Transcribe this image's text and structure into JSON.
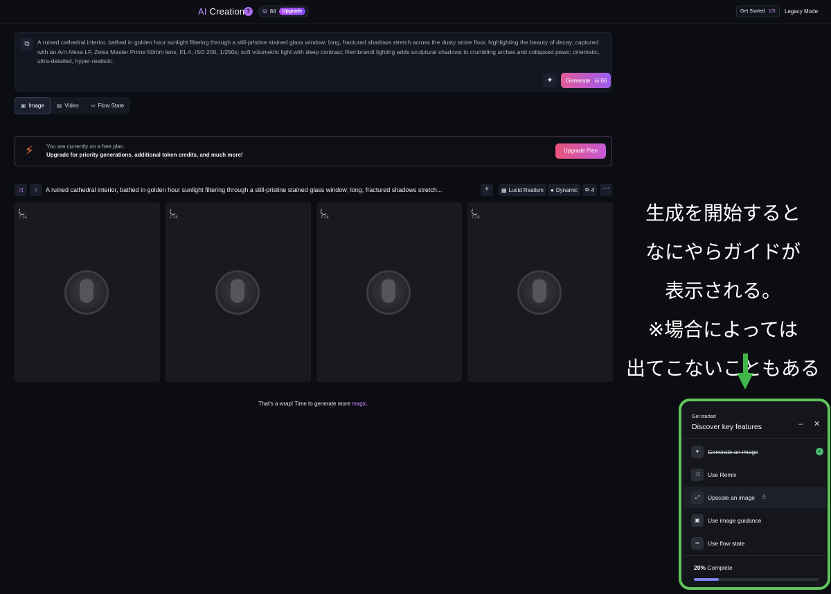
{
  "topbar": {
    "title_ai": "AI",
    "title_rest": " Creation",
    "help_icon": "?",
    "tokens": "84",
    "upgrade_badge": "Upgrade",
    "get_started_label": "Get Started",
    "get_started_count": "1/5",
    "legacy_mode": "Legacy Mode"
  },
  "prompt": {
    "text": "A ruined cathedral interior, bathed in golden hour sunlight filtering through a still-pristine stained glass window; long, fractured shadows stretch across the dusty stone floor, highlighting the beauty of decay; captured with an Arri Alexa LF, Zeiss Master Prime 50mm lens, f/1.4, ISO 200, 1/250s; soft volumetric light with deep contrast; Rembrandt lighting adds sculptural shadows to crumbling arches and collapsed pews; cinematic, ultra-detailed, hyper-realistic.",
    "generate_label": "Generate",
    "generate_cost": "66"
  },
  "mode_tabs": [
    {
      "label": "Image",
      "icon": "image-icon"
    },
    {
      "label": "Video",
      "icon": "video-icon"
    },
    {
      "label": "Flow State",
      "icon": "infinity-icon"
    }
  ],
  "plan_banner": {
    "line1": "You are currently on a free plan.",
    "line2": "Upgrade for priority generations, additional token credits, and much more!",
    "button": "Upgrade Plan"
  },
  "generation": {
    "prompt_preview": "A ruined cathedral interior, bathed in golden hour sunlight filtering through a still-pristine stained glass window; long, fractured shadows stretch...",
    "model": "Lucid Realism",
    "style": "Dynamic",
    "count": "4",
    "tiles": [
      {
        "eta": "7:14"
      },
      {
        "eta": "7:14"
      },
      {
        "eta": "7:14"
      },
      {
        "eta": "7:14"
      }
    ]
  },
  "footer": {
    "wrap_text": "That's a wrap! Time to generate more ",
    "magic": "magic."
  },
  "annotation": {
    "lines": [
      "生成を開始すると",
      "なにやらガイドが",
      "表示される。",
      "※場合によっては",
      "出てこないこともある"
    ],
    "arrow_color": "#3fb54a"
  },
  "get_started_panel": {
    "kicker": "Get started",
    "title": "Discover key features",
    "items": [
      {
        "label": "Generate an image",
        "done": true,
        "icon": "sparkle-icon"
      },
      {
        "label": "Use Remix",
        "done": false,
        "icon": "remix-icon"
      },
      {
        "label": "Upscale an image",
        "done": false,
        "icon": "upscale-icon"
      },
      {
        "label": "Use image guidance",
        "done": false,
        "icon": "image-guidance-icon"
      },
      {
        "label": "Use flow state",
        "done": false,
        "icon": "infinity-icon"
      }
    ],
    "progress_percent": "20%",
    "progress_label": "Complete",
    "progress_value": 0.2,
    "border_color": "#5fc45a"
  }
}
